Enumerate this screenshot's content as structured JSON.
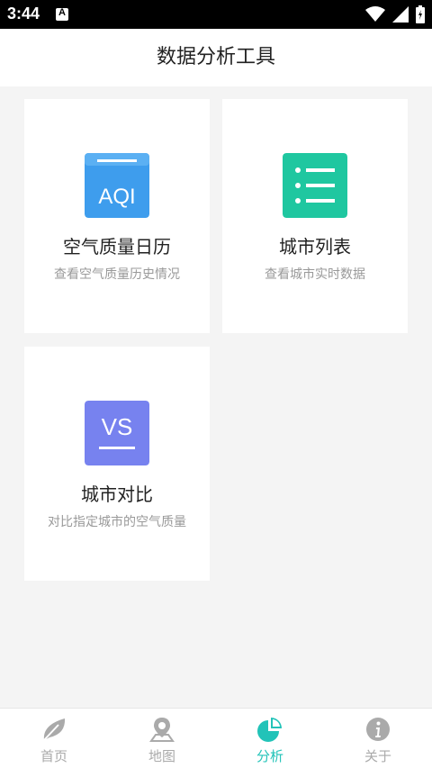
{
  "status_bar": {
    "time": "3:44"
  },
  "header": {
    "title": "数据分析工具"
  },
  "cards": [
    {
      "icon_text": "AQI",
      "icon_color": "#3e9ded",
      "title": "空气质量日历",
      "description": "查看空气质量历史情况"
    },
    {
      "icon_color": "#1fc7a0",
      "title": "城市列表",
      "description": "查看城市实时数据"
    },
    {
      "icon_text": "VS",
      "icon_color": "#7782ef",
      "title": "城市对比",
      "description": "对比指定城市的空气质量"
    }
  ],
  "tabs": [
    {
      "label": "首页",
      "active": false
    },
    {
      "label": "地图",
      "active": false
    },
    {
      "label": "分析",
      "active": true
    },
    {
      "label": "关于",
      "active": false
    }
  ],
  "colors": {
    "accent": "#22c3b8",
    "inactive": "#aaaaaa"
  }
}
